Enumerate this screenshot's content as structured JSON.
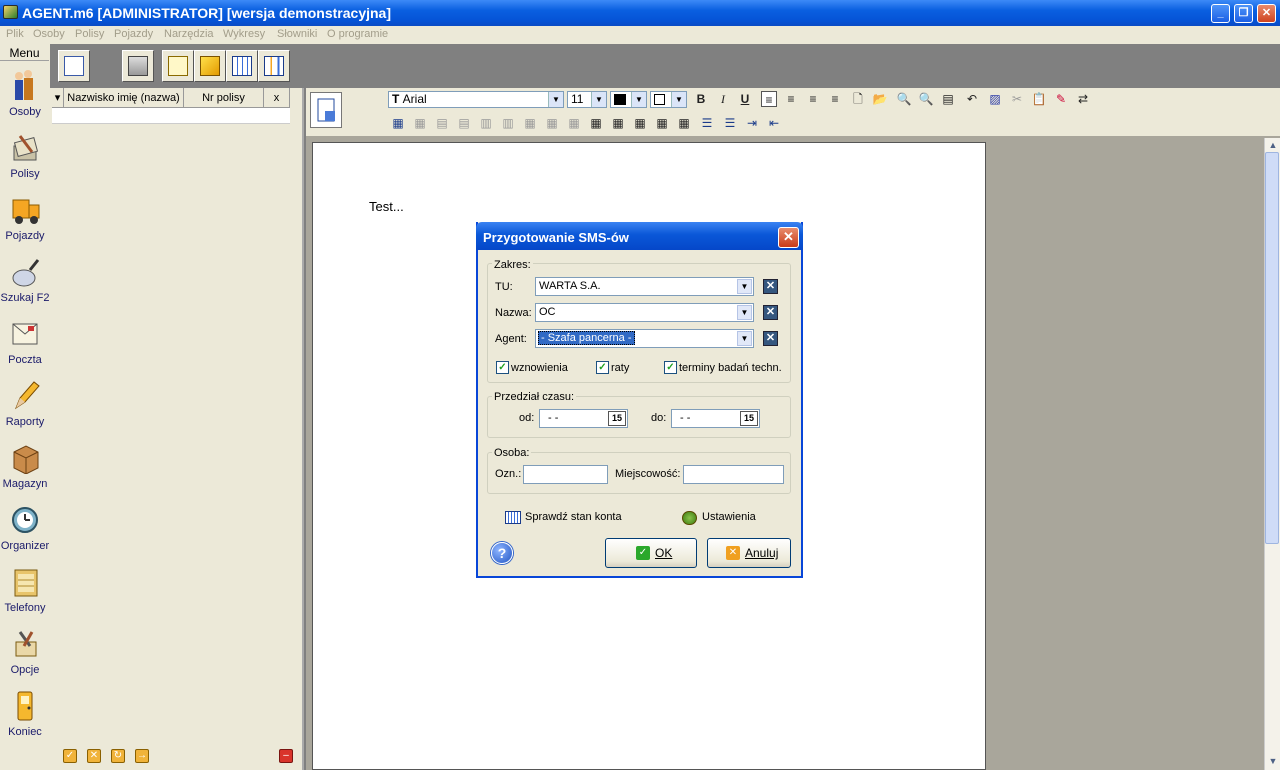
{
  "window": {
    "title": "AGENT.m6 [ADMINISTRATOR] [wersja demonstracyjna]"
  },
  "menu": [
    "Plik",
    "Osoby",
    "Polisy",
    "Pojazdy",
    "Narzędzia",
    "Wykresy",
    "Słowniki",
    "O programie"
  ],
  "sidebar": {
    "header": "Menu",
    "items": [
      {
        "label": "Osoby",
        "icon": "people-icon"
      },
      {
        "label": "Polisy",
        "icon": "policy-stack-icon"
      },
      {
        "label": "Pojazdy",
        "icon": "truck-icon"
      },
      {
        "label": "Szukaj F2",
        "icon": "magnifier-icon"
      },
      {
        "label": "Poczta",
        "icon": "mail-icon"
      },
      {
        "label": "Raporty",
        "icon": "pencil-icon"
      },
      {
        "label": "Magazyn",
        "icon": "box-icon"
      },
      {
        "label": "Organizer",
        "icon": "clock-icon"
      },
      {
        "label": "Telefony",
        "icon": "phone-book-icon"
      },
      {
        "label": "Opcje",
        "icon": "tools-icon"
      },
      {
        "label": "Koniec",
        "icon": "exit-door-icon"
      }
    ]
  },
  "grid": {
    "columns": [
      "Nazwisko imię (nazwa)",
      "Nr polisy",
      "x"
    ]
  },
  "formatting": {
    "font": "Arial",
    "size": "11"
  },
  "document": {
    "text": "Test..."
  },
  "dialog": {
    "title": "Przygotowanie SMS-ów",
    "scope": {
      "legend": "Zakres:",
      "tu_label": "TU:",
      "tu_value": "WARTA S.A.",
      "nazwa_label": "Nazwa:",
      "nazwa_value": "OC",
      "agent_label": "Agent:",
      "agent_value": "- Szafa pancerna -",
      "checks": [
        {
          "label": "wznowienia",
          "checked": true
        },
        {
          "label": "raty",
          "checked": true
        },
        {
          "label": "terminy badań techn.",
          "checked": true
        }
      ]
    },
    "period": {
      "legend": "Przedział czasu:",
      "from_label": "od:",
      "from_value": "- -",
      "to_label": "do:",
      "to_value": "- -",
      "cal_glyph": "15"
    },
    "person": {
      "legend": "Osoba:",
      "ozn_label": "Ozn.:",
      "ozn_value": "",
      "city_label": "Miejscowość:",
      "city_value": ""
    },
    "links": {
      "balance": "Sprawdź stan konta",
      "settings": "Ustawienia"
    },
    "buttons": {
      "ok": "OK",
      "cancel": "Anuluj",
      "help": "?"
    }
  },
  "colors": {
    "xp_blue": "#0a5fe0",
    "face": "#ece9d8",
    "selection": "#316ac5",
    "close_red": "#c93a17"
  }
}
